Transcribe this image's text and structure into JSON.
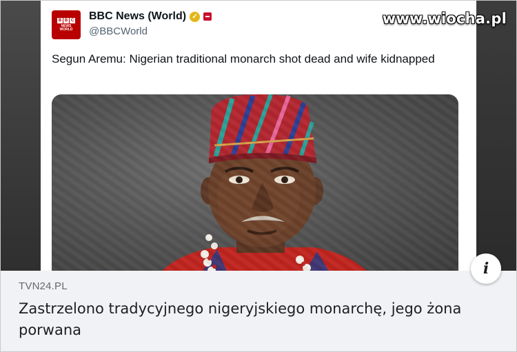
{
  "watermark": "www.wiocha.pl",
  "tweet": {
    "display_name": "BBC News (World)",
    "handle": "@BBCWorld",
    "avatar_logo": [
      "B",
      "B",
      "C"
    ],
    "avatar_sub": "NEWS\nWORLD",
    "text": "Segun Aremu: Nigerian traditional monarch shot dead and wife kidnapped",
    "verified_color": "#e2b719",
    "affiliation_color": "#c8102e"
  },
  "link_preview": {
    "source": "TVN24.PL",
    "headline": "Zastrzelono tradycyjnego nigeryjskiego monarchę, jego żona porwana",
    "info_icon": "i"
  },
  "colors": {
    "bbc_red": "#b80000",
    "caption_bg": "#f0f2f5"
  }
}
